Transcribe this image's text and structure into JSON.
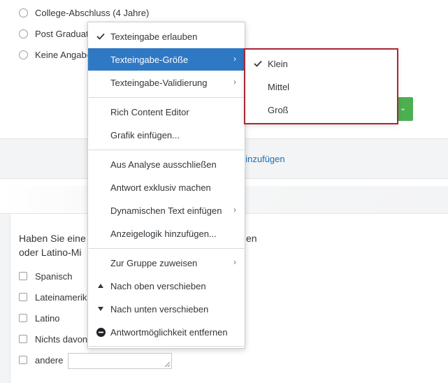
{
  "question1": {
    "options": [
      "College-Abschluss (4 Jahre)",
      "Post Graduat",
      "Keine Angabe"
    ]
  },
  "add_choice_label": "hinzufügen",
  "question2": {
    "text": "Haben Sie eine\noder Latino-Mi",
    "text_right": "en",
    "options": [
      "Spanisch",
      "Lateinamerik",
      "Latino",
      "Nichts davon",
      "andere"
    ]
  },
  "context_menu": {
    "items": [
      {
        "label": "Texteingabe erlauben",
        "lead_icon": "check-icon",
        "submenu": false
      },
      {
        "label": "Texteingabe-Größe",
        "lead_icon": "",
        "submenu": true,
        "active": true
      },
      {
        "label": "Texteingabe-Validierung",
        "lead_icon": "",
        "submenu": true
      },
      {
        "label": "Rich Content Editor",
        "lead_icon": "",
        "submenu": false
      },
      {
        "label": "Grafik einfügen...",
        "lead_icon": "",
        "submenu": false
      },
      {
        "label": "Aus Analyse ausschließen",
        "lead_icon": "",
        "submenu": false
      },
      {
        "label": "Antwort exklusiv machen",
        "lead_icon": "",
        "submenu": false
      },
      {
        "label": "Dynamischen Text einfügen",
        "lead_icon": "",
        "submenu": true
      },
      {
        "label": "Anzeigelogik hinzufügen...",
        "lead_icon": "",
        "submenu": false
      },
      {
        "label": "Zur Gruppe zuweisen",
        "lead_icon": "",
        "submenu": true
      },
      {
        "label": "Nach oben verschieben",
        "lead_icon": "triangle-up-icon",
        "submenu": false
      },
      {
        "label": "Nach unten verschieben",
        "lead_icon": "triangle-down-icon",
        "submenu": false
      },
      {
        "label": "Antwortmöglichkeit entfernen",
        "lead_icon": "minus-circle-icon",
        "submenu": false
      }
    ]
  },
  "size_submenu": {
    "items": [
      {
        "label": "Klein",
        "checked": true
      },
      {
        "label": "Mittel",
        "checked": false
      },
      {
        "label": "Groß",
        "checked": false
      }
    ]
  },
  "colors": {
    "menu_active": "#2f78c4",
    "submenu_highlight_border": "#a82735",
    "link": "#1d6fb8",
    "green_button": "#4caf50"
  }
}
